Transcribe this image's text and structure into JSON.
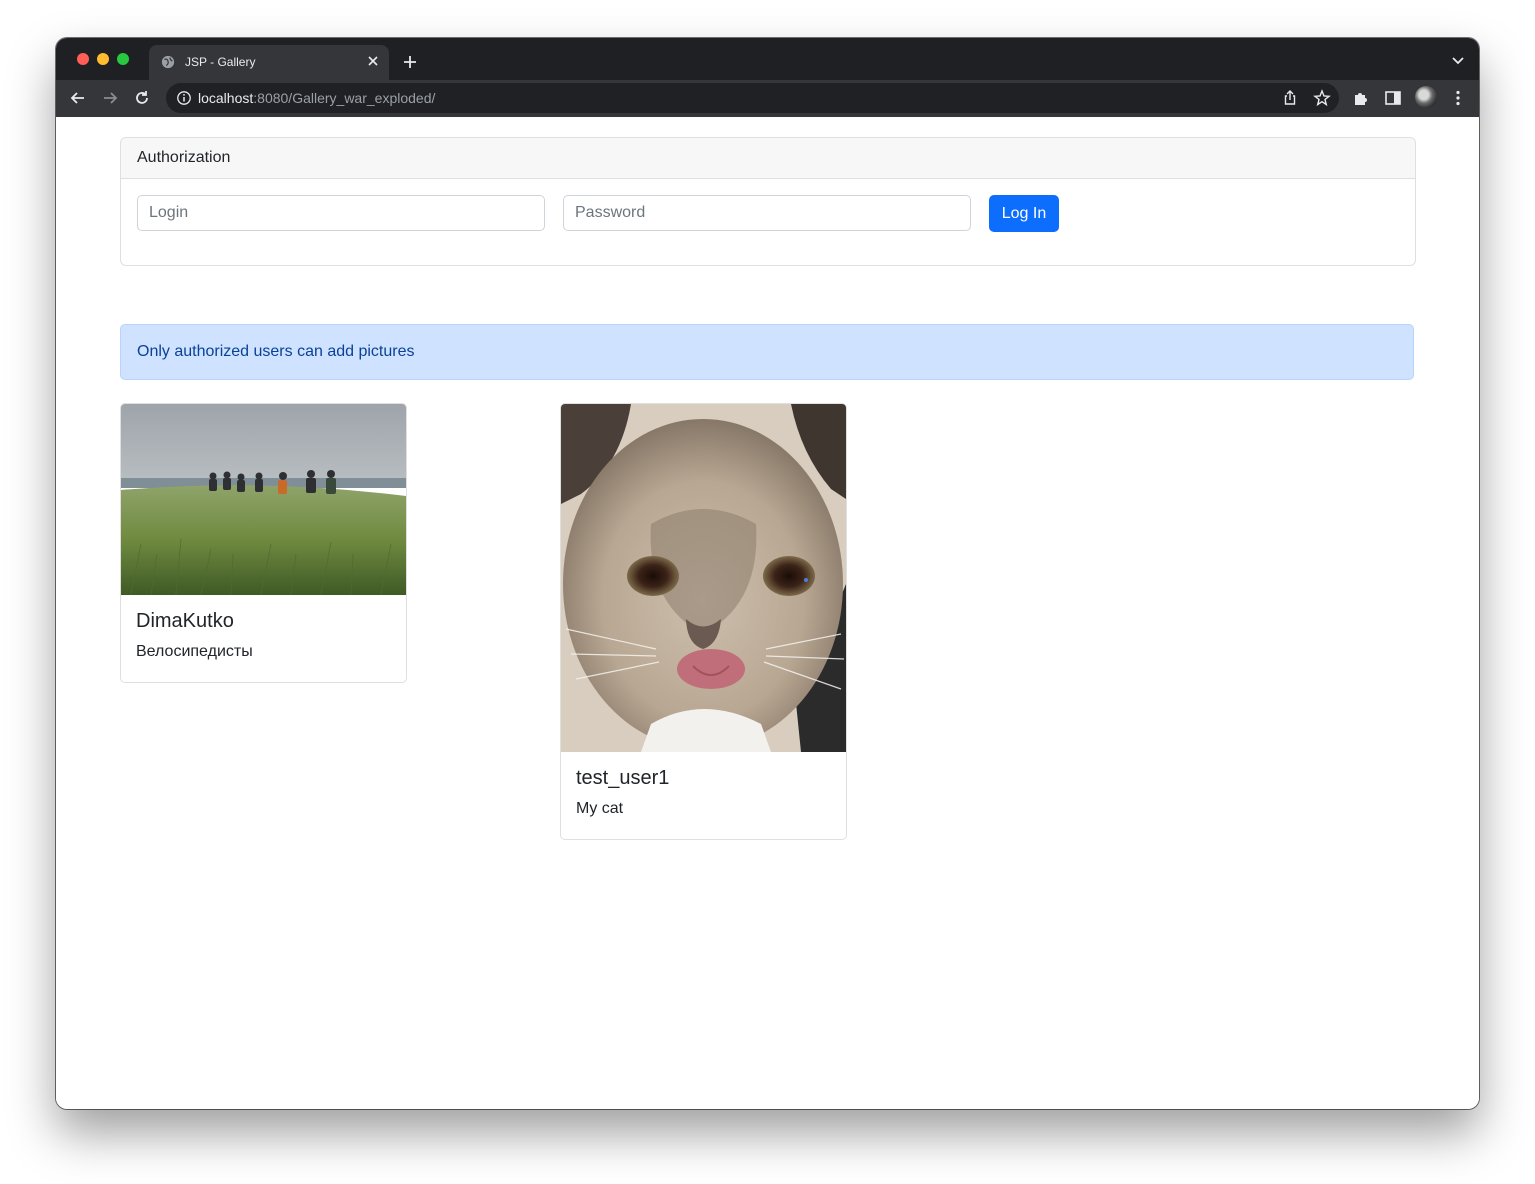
{
  "browser": {
    "tab_title": "JSP - Gallery",
    "url_host": "localhost",
    "url_rest": ":8080/Gallery_war_exploded/"
  },
  "auth": {
    "header": "Authorization",
    "login_placeholder": "Login",
    "password_placeholder": "Password",
    "login_button": "Log In"
  },
  "alert": {
    "text": "Only authorized users can add pictures"
  },
  "gallery": [
    {
      "author": "DimaKutko",
      "caption": "Велосипедисты",
      "image": "cyclists-on-grass-field"
    },
    {
      "author": "test_user1",
      "caption": "My cat",
      "image": "cat-with-tongue-out"
    }
  ],
  "colors": {
    "primary": "#0d6efd",
    "alert_bg": "#cfe2ff",
    "alert_text": "#084298",
    "browser_frame": "#1f2023",
    "toolbar": "#35363a"
  }
}
